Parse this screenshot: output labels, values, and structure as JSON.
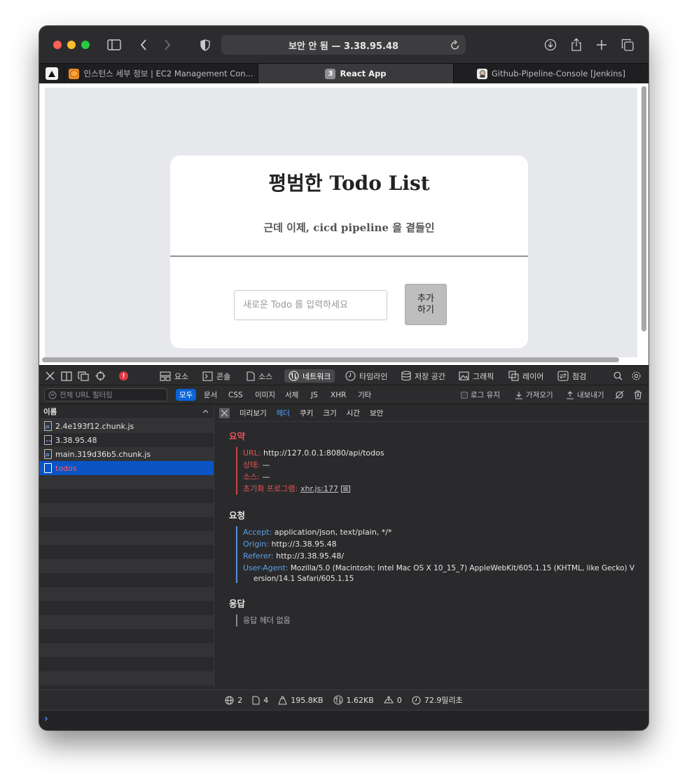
{
  "browser": {
    "url_text": "보안 안 됨 — 3.38.95.48",
    "tabs": [
      {
        "label": "인스턴스 세부 정보 | EC2 Management Con...",
        "icon": "aws-cube-icon",
        "active": false
      },
      {
        "label": "React App",
        "badge": "3",
        "active": true
      },
      {
        "label": "Github-Pipeline-Console [Jenkins]",
        "icon": "jenkins-icon",
        "active": false
      }
    ]
  },
  "app": {
    "title": "평범한 Todo List",
    "subtitle": "근데 이제, cicd pipeline 을 곁들인",
    "input_placeholder": "새로운 Todo 를 입력하세요",
    "add_label": "추가\n하기"
  },
  "devtools": {
    "tabs": [
      "요소",
      "콘솔",
      "소스",
      "네트워크",
      "타임라인",
      "저장 공간",
      "그래픽",
      "레이어",
      "점검"
    ],
    "error_count": "!",
    "filter_placeholder": "전체 URL 필터링",
    "types": [
      "모두",
      "문서",
      "CSS",
      "이미지",
      "서체",
      "JS",
      "XHR",
      "기타"
    ],
    "right_actions": [
      "로그 유지",
      "가져오기",
      "내보내기"
    ],
    "list_header": "이름",
    "files": [
      {
        "name": "2.4e193f12.chunk.js",
        "kind": "js"
      },
      {
        "name": "3.38.95.48",
        "kind": "html"
      },
      {
        "name": "main.319d36b5.chunk.js",
        "kind": "js"
      },
      {
        "name": "todos",
        "kind": "doc",
        "selected": true
      }
    ],
    "detail_tabs": [
      "미리보기",
      "헤더",
      "쿠키",
      "크기",
      "시간",
      "보안"
    ],
    "summary": {
      "title": "요약",
      "url_key": "URL:",
      "url_val": "http://127.0.0.1:8080/api/todos",
      "status_key": "상태:",
      "status_val": "—",
      "source_key": "소스:",
      "source_val": "—",
      "initiator_key": "초기화 프로그램:",
      "initiator_val": "xhr.js:177"
    },
    "request": {
      "title": "요청",
      "accept_key": "Accept:",
      "accept_val": "application/json, text/plain, */*",
      "origin_key": "Origin:",
      "origin_val": "http://3.38.95.48",
      "referer_key": "Referer:",
      "referer_val": "http://3.38.95.48/",
      "ua_key": "User-Agent:",
      "ua_val1": "Mozilla/5.0 (Macintosh; Intel Mac OS X 10_15_7) AppleWebKit/605.1.15 (KHTML, like Gecko) V",
      "ua_val2": "ersion/14.1 Safari/605.1.15"
    },
    "response": {
      "title": "응답",
      "empty": "응답 헤더 없음"
    },
    "status_bar": {
      "domains": "2",
      "resources": "4",
      "size": "195.8KB",
      "transferred": "1.62KB",
      "errors": "0",
      "time": "72.9밀리초"
    },
    "console_prompt": "›"
  }
}
